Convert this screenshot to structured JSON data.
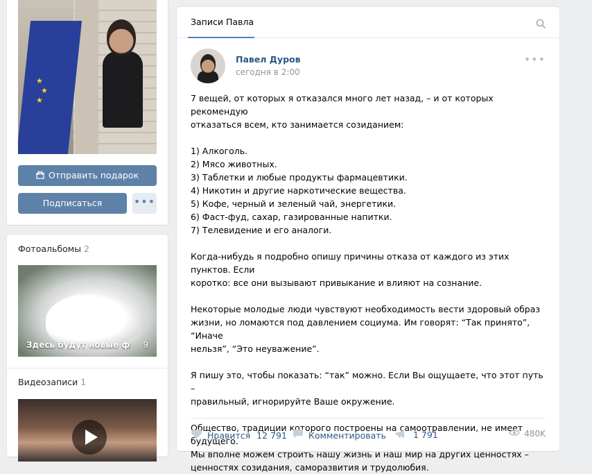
{
  "profile": {
    "gift_button": "Отправить подарок",
    "subscribe_button": "Подписаться",
    "more_button": "•••"
  },
  "albums": {
    "title": "Фотоальбомы",
    "count": "2",
    "album_caption": "Здесь будут новые фотог…",
    "album_count": "9"
  },
  "videos": {
    "title": "Видеозаписи",
    "count": "1"
  },
  "wall": {
    "tab_label": "Записи Павла",
    "post": {
      "author": "Павел Дуров",
      "time": "сегодня в 2:00",
      "menu": "•••",
      "text": "7 вещей, от которых я отказался много лет назад, – и от которых рекомендую\nотказаться всем, кто занимается созиданием:\n\n1) Алкоголь.\n2) Мясо животных.\n3) Таблетки и любые продукты фармацевтики.\n4) Никотин и другие наркотические вещества.\n5) Кофе, черный и зеленый чай, энергетики.\n6) Фаст-фуд, сахар, газированные напитки.\n7) Телевидение и его аналоги.\n\nКогда-нибудь я подробно опишу причины отказа от каждого из этих пунктов. Если\nкоротко: все они вызывают привыкание и влияют на сознание.\n\nНекоторые молодые люди чувствуют необходимость вести здоровый образ\nжизни, но ломаются под давлением социума. Им говорят: “Так принято”, “Иначе\nнельзя”, “Это неуважение”.\n\nЯ пишу это, чтобы показать: “так” можно. Если Вы ощущаете, что этот путь –\nправильный, игнорируйте Ваше окружение.\n\nОбщество, традиции которого построены на самоотравлении, не имеет будущего.\nМы вполне можем строить нашу жизнь и наш мир на других ценностях –\nценностях созидания, саморазвития и трудолюбия.",
      "like_label": "Нравится",
      "like_count": "12 791",
      "comment_label": "Комментировать",
      "share_count": "1 791",
      "views": "480K"
    }
  },
  "colors": {
    "accent": "#5e81a8",
    "link": "#2a5885",
    "muted": "#939393",
    "background": "#edeef0"
  },
  "icons": [
    "gift-icon",
    "search-icon",
    "heart-icon",
    "comment-icon",
    "share-icon",
    "eye-icon",
    "play-icon"
  ]
}
